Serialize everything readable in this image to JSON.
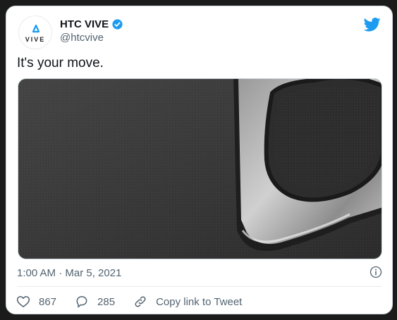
{
  "author": {
    "name": "HTC VIVE",
    "handle": "@htcvive",
    "avatar_text": "VIVE",
    "verified": true
  },
  "tweet": {
    "text": "It's your move.",
    "timestamp": "1:00 AM · Mar 5, 2021"
  },
  "actions": {
    "likes": "867",
    "replies": "285",
    "copy_link": "Copy link to Tweet"
  },
  "icons": {
    "bird": "twitter-bird-icon",
    "verified": "verified-badge-icon",
    "info": "info-icon",
    "like": "heart-icon",
    "reply": "reply-icon",
    "link": "link-icon"
  },
  "colors": {
    "twitter_blue": "#1d9bf0",
    "text_primary": "#0f1419",
    "text_secondary": "#536471"
  }
}
